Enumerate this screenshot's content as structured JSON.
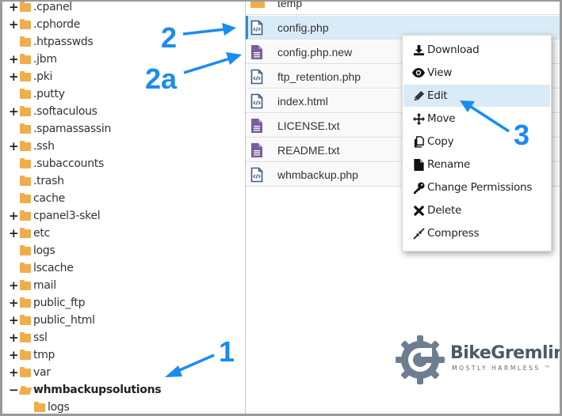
{
  "tree": {
    "items": [
      {
        "label": ".cpanel",
        "toggle": "+",
        "bold": false,
        "open": false
      },
      {
        "label": ".cphorde",
        "toggle": "+",
        "bold": false,
        "open": false
      },
      {
        "label": ".htpasswds",
        "toggle": "",
        "bold": false,
        "open": false
      },
      {
        "label": ".jbm",
        "toggle": "+",
        "bold": false,
        "open": false
      },
      {
        "label": ".pki",
        "toggle": "+",
        "bold": false,
        "open": false
      },
      {
        "label": ".putty",
        "toggle": "",
        "bold": false,
        "open": false
      },
      {
        "label": ".softaculous",
        "toggle": "+",
        "bold": false,
        "open": false
      },
      {
        "label": ".spamassassin",
        "toggle": "",
        "bold": false,
        "open": false
      },
      {
        "label": ".ssh",
        "toggle": "+",
        "bold": false,
        "open": false
      },
      {
        "label": ".subaccounts",
        "toggle": "",
        "bold": false,
        "open": false
      },
      {
        "label": ".trash",
        "toggle": "",
        "bold": false,
        "open": false
      },
      {
        "label": "cache",
        "toggle": "",
        "bold": false,
        "open": false
      },
      {
        "label": "cpanel3-skel",
        "toggle": "+",
        "bold": false,
        "open": false
      },
      {
        "label": "etc",
        "toggle": "+",
        "bold": false,
        "open": false
      },
      {
        "label": "logs",
        "toggle": "",
        "bold": false,
        "open": false
      },
      {
        "label": "lscache",
        "toggle": "",
        "bold": false,
        "open": false
      },
      {
        "label": "mail",
        "toggle": "+",
        "bold": false,
        "open": false
      },
      {
        "label": "public_ftp",
        "toggle": "+",
        "bold": false,
        "open": false
      },
      {
        "label": "public_html",
        "toggle": "+",
        "bold": false,
        "open": false
      },
      {
        "label": "ssl",
        "toggle": "+",
        "bold": false,
        "open": false
      },
      {
        "label": "tmp",
        "toggle": "+",
        "bold": false,
        "open": false
      },
      {
        "label": "var",
        "toggle": "+",
        "bold": false,
        "open": false
      },
      {
        "label": "whmbackupsolutions",
        "toggle": "−",
        "bold": true,
        "open": true
      },
      {
        "label": "logs",
        "toggle": "",
        "bold": false,
        "open": false,
        "child": true
      }
    ]
  },
  "files": {
    "rows": [
      {
        "name": "temp",
        "type": "folder",
        "selected": false
      },
      {
        "name": "config.php",
        "type": "code",
        "selected": true
      },
      {
        "name": "config.php.new",
        "type": "text",
        "selected": false
      },
      {
        "name": "ftp_retention.php",
        "type": "code",
        "selected": false
      },
      {
        "name": "index.html",
        "type": "code",
        "selected": false
      },
      {
        "name": "LICENSE.txt",
        "type": "text",
        "selected": false
      },
      {
        "name": "README.txt",
        "type": "text",
        "selected": false
      },
      {
        "name": "whmbackup.php",
        "type": "code",
        "selected": false
      }
    ]
  },
  "context_menu": {
    "items": [
      {
        "label": "Download",
        "icon": "download-icon",
        "active": false
      },
      {
        "label": "View",
        "icon": "eye-icon",
        "active": false
      },
      {
        "label": "Edit",
        "icon": "pencil-icon",
        "active": true
      },
      {
        "label": "Move",
        "icon": "move-icon",
        "active": false
      },
      {
        "label": "Copy",
        "icon": "copy-icon",
        "active": false
      },
      {
        "label": "Rename",
        "icon": "file-icon",
        "active": false
      },
      {
        "label": "Change Permissions",
        "icon": "key-icon",
        "active": false
      },
      {
        "label": "Delete",
        "icon": "delete-icon",
        "active": false
      },
      {
        "label": "Compress",
        "icon": "compress-icon",
        "active": false
      }
    ]
  },
  "annotations": {
    "a1": "1",
    "a2": "2",
    "a2a": "2a",
    "a3": "3",
    "color": "#1a8cf0"
  },
  "logo": {
    "title": "BikeGremlin",
    "subtitle": "MOSTLY HARMLESS ™"
  },
  "colors": {
    "folder": "#f0ad4e",
    "selection": "#d9ebf7",
    "selection_border": "#2a8fd4",
    "code_icon": "#3d5a80",
    "text_icon": "#7b5c9c"
  }
}
